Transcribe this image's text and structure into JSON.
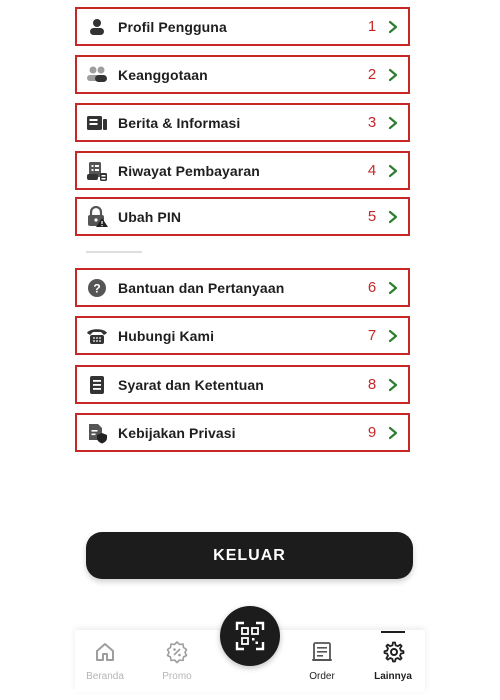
{
  "menu": {
    "items": [
      {
        "label": "Profil Pengguna",
        "number": "1",
        "icon": "user-icon"
      },
      {
        "label": "Keanggotaan",
        "number": "2",
        "icon": "membership-icon"
      },
      {
        "label": "Berita & Informasi",
        "number": "3",
        "icon": "news-icon"
      },
      {
        "label": "Riwayat Pembayaran",
        "number": "4",
        "icon": "payment-history-icon"
      },
      {
        "label": "Ubah PIN",
        "number": "5",
        "icon": "lock-warning-icon"
      },
      {
        "label": "Bantuan dan Pertanyaan",
        "number": "6",
        "icon": "question-icon"
      },
      {
        "label": "Hubungi Kami",
        "number": "7",
        "icon": "phone-icon"
      },
      {
        "label": "Syarat dan Ketentuan",
        "number": "8",
        "icon": "document-icon"
      },
      {
        "label": "Kebijakan Privasi",
        "number": "9",
        "icon": "privacy-shield-icon"
      }
    ]
  },
  "logout_label": "KELUAR",
  "nav": {
    "items": [
      {
        "label": "Beranda",
        "icon": "home-icon"
      },
      {
        "label": "Promo",
        "icon": "promo-icon"
      },
      {
        "label": "Order",
        "icon": "order-icon"
      },
      {
        "label": "Lainnya",
        "icon": "gear-icon"
      }
    ],
    "scan_icon": "qr-scan-icon",
    "active": "Lainnya"
  },
  "colors": {
    "annotation_red": "#c62828",
    "chevron_green": "#2e7d32",
    "dark": "#1c1c1c",
    "inactive_gray": "#b5b5b5"
  }
}
